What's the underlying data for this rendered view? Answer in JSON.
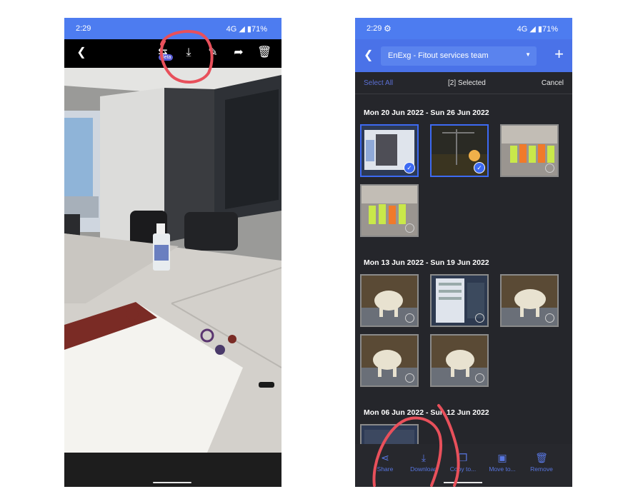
{
  "left_phone": {
    "status": {
      "time": "2:29",
      "network": "4G ◢ ▮71%"
    },
    "toolbar": {
      "back_icon": "chevron-left-icon",
      "beta_label": "Beta",
      "icons": [
        "add-icon",
        "download-icon",
        "edit-icon",
        "share-icon",
        "trash-icon"
      ]
    }
  },
  "right_phone": {
    "status": {
      "time": "2:29",
      "network": "4G ◢ ▮71%"
    },
    "header": {
      "team": "EnExg - Fitout services team"
    },
    "selection": {
      "select_all": "Select All",
      "selected": "[2] Selected",
      "cancel": "Cancel"
    },
    "groups": [
      {
        "date": "Mon 20 Jun 2022 - Sun 26 Jun 2022"
      },
      {
        "date": "Mon 13 Jun 2022 - Sun 19 Jun 2022"
      },
      {
        "date": "Mon 06 Jun 2022 - Sun 12 Jun 2022"
      }
    ],
    "bottom_actions": [
      {
        "label": "Share",
        "icon": "share-icon"
      },
      {
        "label": "Download",
        "icon": "download-icon"
      },
      {
        "label": "Copy to...",
        "icon": "copy-icon"
      },
      {
        "label": "Move to...",
        "icon": "folder-move-icon"
      },
      {
        "label": "Remove",
        "icon": "trash-icon"
      }
    ]
  },
  "colors": {
    "accent": "#4a72e8",
    "annotation": "#e8505b"
  }
}
